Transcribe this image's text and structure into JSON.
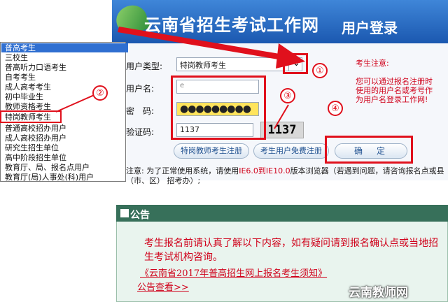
{
  "header": {
    "site_title": "云南省招生考试工作网",
    "login_title": "用户登录"
  },
  "form": {
    "user_type_label": "用户类型:",
    "user_type_value": "特岗教师考生",
    "username_label": "用户名:",
    "username_value": "e   ",
    "password_label": "密　码:",
    "password_value": "●●●●●●●●●",
    "captcha_label": "验证码:",
    "captcha_value": "1137",
    "captcha_image_text": "1137"
  },
  "buttons": {
    "teacher_register": "特岗教师考生注册",
    "free_register": "考生用户免费注册",
    "confirm": "确　定"
  },
  "notice": {
    "title": "考生注意:",
    "body": "您可以通过报名注册时使用的用户名或考号作为用户名登录工作网!"
  },
  "footer_note": {
    "prefix": "注意: 为了正常使用系统，请使用",
    "browser": "IE6.0到IE10.0",
    "suffix": "版本浏览器（若遇到问题，请咨询报名点或县（市、区） 招考办）;"
  },
  "dropdown": {
    "items": [
      "普高考生",
      "三校生",
      "普高听力口语考生",
      "自考考生",
      "成人高考考生",
      "初中毕业生",
      "教师资格考生",
      "特岗教师考生",
      "普通高校招办用户",
      "成人高校招办用户",
      "研究生招生单位",
      "高中阶段招生单位",
      "教育厅、局、报名点用户",
      "教育厅(局)人事处(科)用户"
    ]
  },
  "annotations": [
    "①",
    "②",
    "③",
    "④"
  ],
  "bulletin": {
    "title": "公告",
    "text": "考生报名前请认真了解以下内容，如有疑问请到报名确认点或当地招生考试机构咨询。",
    "link": "《云南省2017年普高招生网上报名考生须知》",
    "more": "公告查看>>"
  },
  "watermark": "云南教师网",
  "colors": {
    "accent_red": "#e0101c",
    "banner_blue": "#2a6cc6",
    "bulletin_green": "#37705a"
  }
}
